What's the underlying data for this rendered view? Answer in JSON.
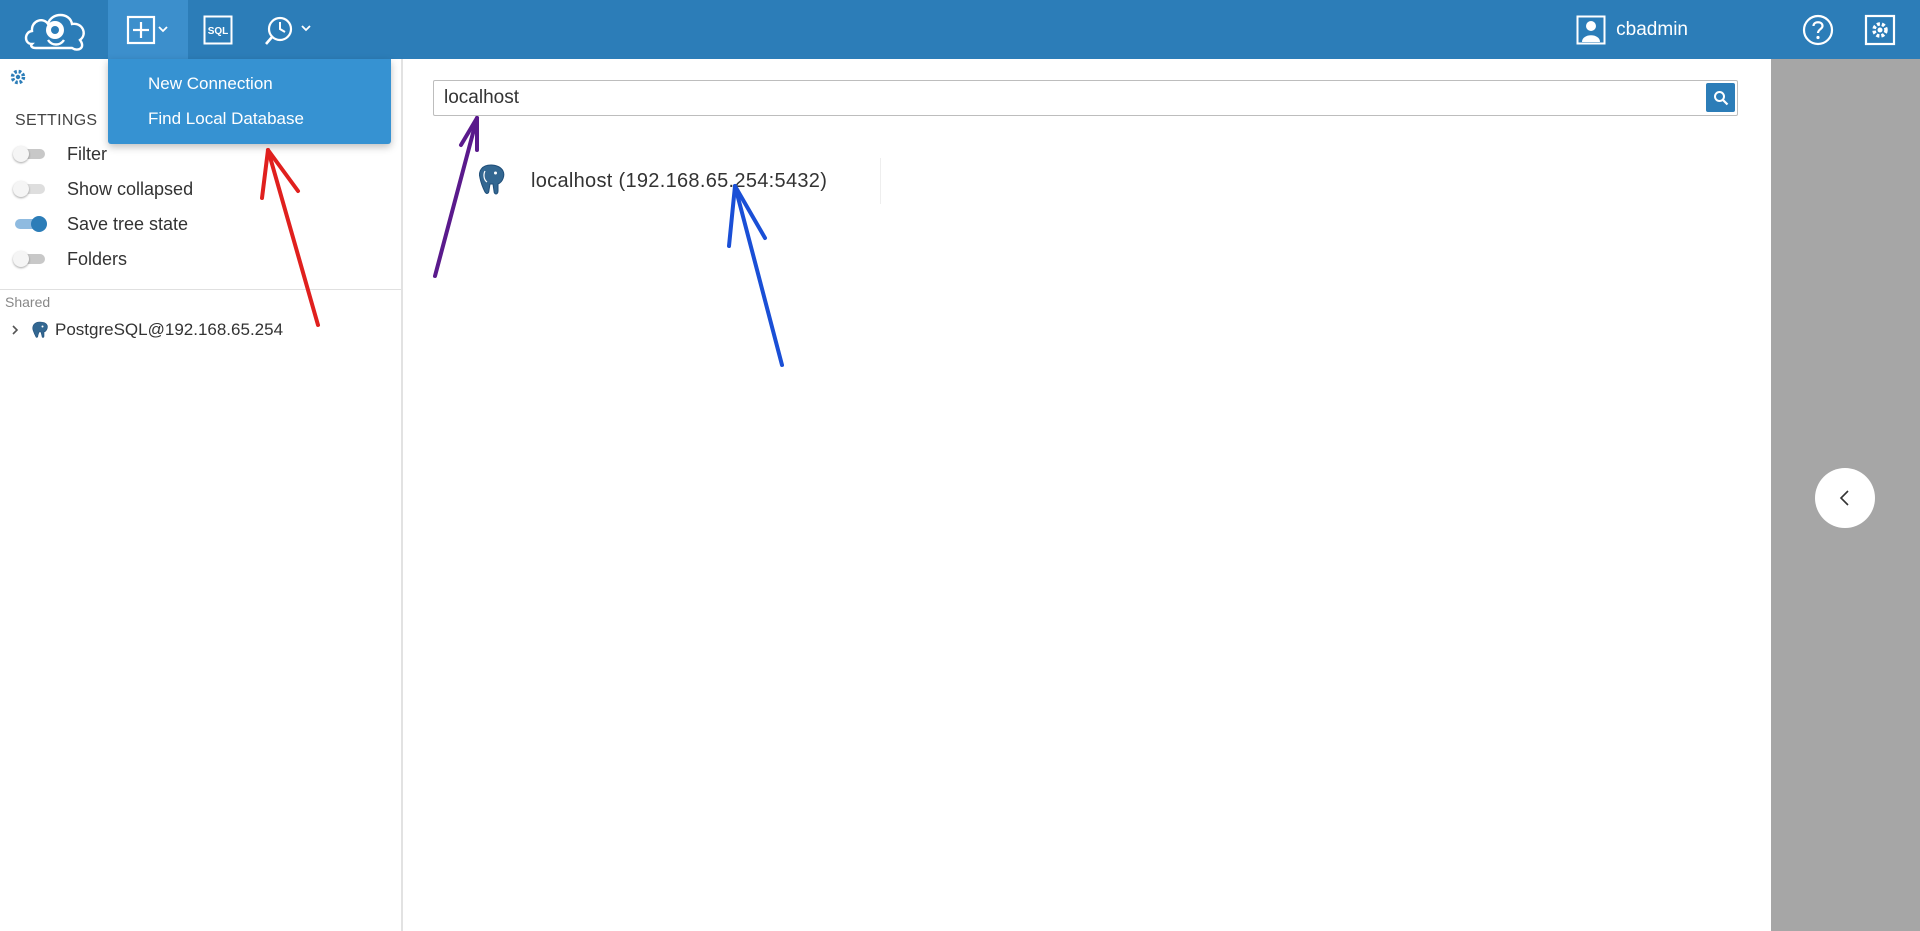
{
  "header": {
    "user_name": "cbadmin",
    "icons": [
      "cloudbeaver-logo-icon",
      "new-connection-plus-icon",
      "sql-editor-icon",
      "tools-icon",
      "user-avatar-icon",
      "help-icon",
      "settings-gear-icon"
    ]
  },
  "new_menu": {
    "items": [
      "New Connection",
      "Find Local Database"
    ]
  },
  "navigator": {
    "settings_title": "SETTINGS",
    "settings": [
      {
        "label": "Filter",
        "on": false
      },
      {
        "label": "Show collapsed",
        "on": false
      },
      {
        "label": "Save tree state",
        "on": true
      },
      {
        "label": "Folders",
        "on": false
      }
    ],
    "section_label": "Shared",
    "tree": [
      {
        "label": "PostgreSQL@192.168.65.254",
        "icon": "postgresql-elephant-icon",
        "expanded": false
      }
    ]
  },
  "search": {
    "value": "localhost"
  },
  "results": [
    {
      "label": "localhost (192.168.65.254:5432)",
      "icon": "postgresql-elephant-icon"
    }
  ],
  "colors": {
    "topbar": "#2c7db8",
    "dropdown": "#3692d2",
    "right_panel": "#a6a6a6",
    "annotation_red": "#e0201e",
    "annotation_purple": "#5a1a8c",
    "annotation_blue": "#1a4fd6"
  }
}
